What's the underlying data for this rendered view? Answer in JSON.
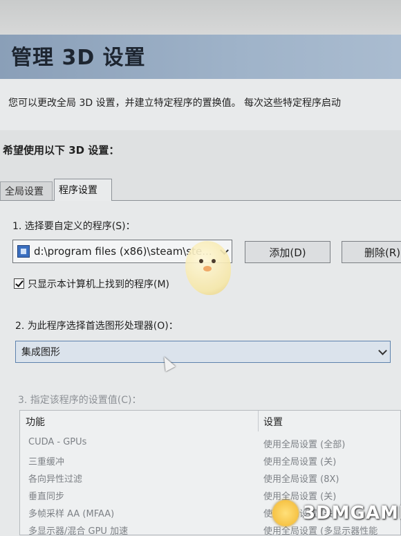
{
  "header": {
    "title": "管理 3D 设置",
    "description": "您可以更改全局 3D 设置，并建立特定程序的置换值。 每次这些特定程序启动"
  },
  "section": {
    "want_label": "希望使用以下 3D 设置："
  },
  "tabs": [
    {
      "label": "全局设置",
      "active": false
    },
    {
      "label": "程序设置",
      "active": true
    }
  ],
  "step1": {
    "label": "1. 选择要自定义的程序(S)：",
    "selected_program": "d:\\program files (x86)\\steam\\ste...",
    "add_button": "添加(D)",
    "remove_button": "删除(R)",
    "checkbox_label": "只显示本计算机上找到的程序(M)",
    "checkbox_checked": true
  },
  "step2": {
    "label": "2. 为此程序选择首选图形处理器(O)：",
    "selected_gpu": "集成图形"
  },
  "step3": {
    "label": "3. 指定该程序的设置值(C)：",
    "columns": {
      "feature": "功能",
      "setting": "设置"
    },
    "rows": [
      {
        "feature": "CUDA - GPUs",
        "setting": "使用全局设置 (全部)"
      },
      {
        "feature": "三重缓冲",
        "setting": "使用全局设置 (关)"
      },
      {
        "feature": "各向异性过滤",
        "setting": "使用全局设置 (8X)"
      },
      {
        "feature": "垂直同步",
        "setting": "使用全局设置 (关)"
      },
      {
        "feature": "多帧采样 AA (MFAA)",
        "setting": "使用全局设置 (关)"
      },
      {
        "feature": "多显示器/混合 GPU 加速",
        "setting": "使用全局设置 (多显示器性能"
      }
    ]
  },
  "watermark": {
    "text": "3DMGAME"
  },
  "colors": {
    "header_bg": "#9fb3c9",
    "dropdown_border": "#5d82ad",
    "panel_bg": "#e7e9ea",
    "disabled_text": "#8d9196"
  }
}
